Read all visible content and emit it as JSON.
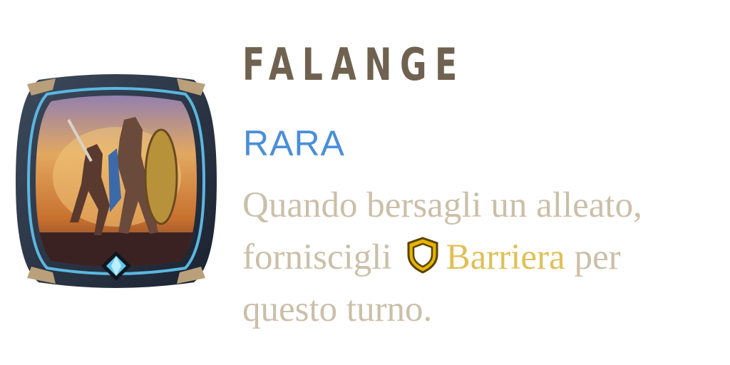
{
  "card": {
    "name": "FALANGE",
    "rarity": "RARA",
    "description": {
      "line1": "Quando bersagli un alleato,",
      "line2_pre": "forniscigli",
      "keyword": "Barriera",
      "line2_post": " per",
      "line3": "questo turno."
    },
    "keyword_icon": "shield-icon",
    "art_icon": "warrior-artwork",
    "gem_icon": "diamond-gem-icon"
  },
  "colors": {
    "title": "#6f6250",
    "rarity": "#4a8fd8",
    "description": "#cbbfa8",
    "keyword": "#e0c056",
    "frame_accent": "#5bb7e0"
  }
}
